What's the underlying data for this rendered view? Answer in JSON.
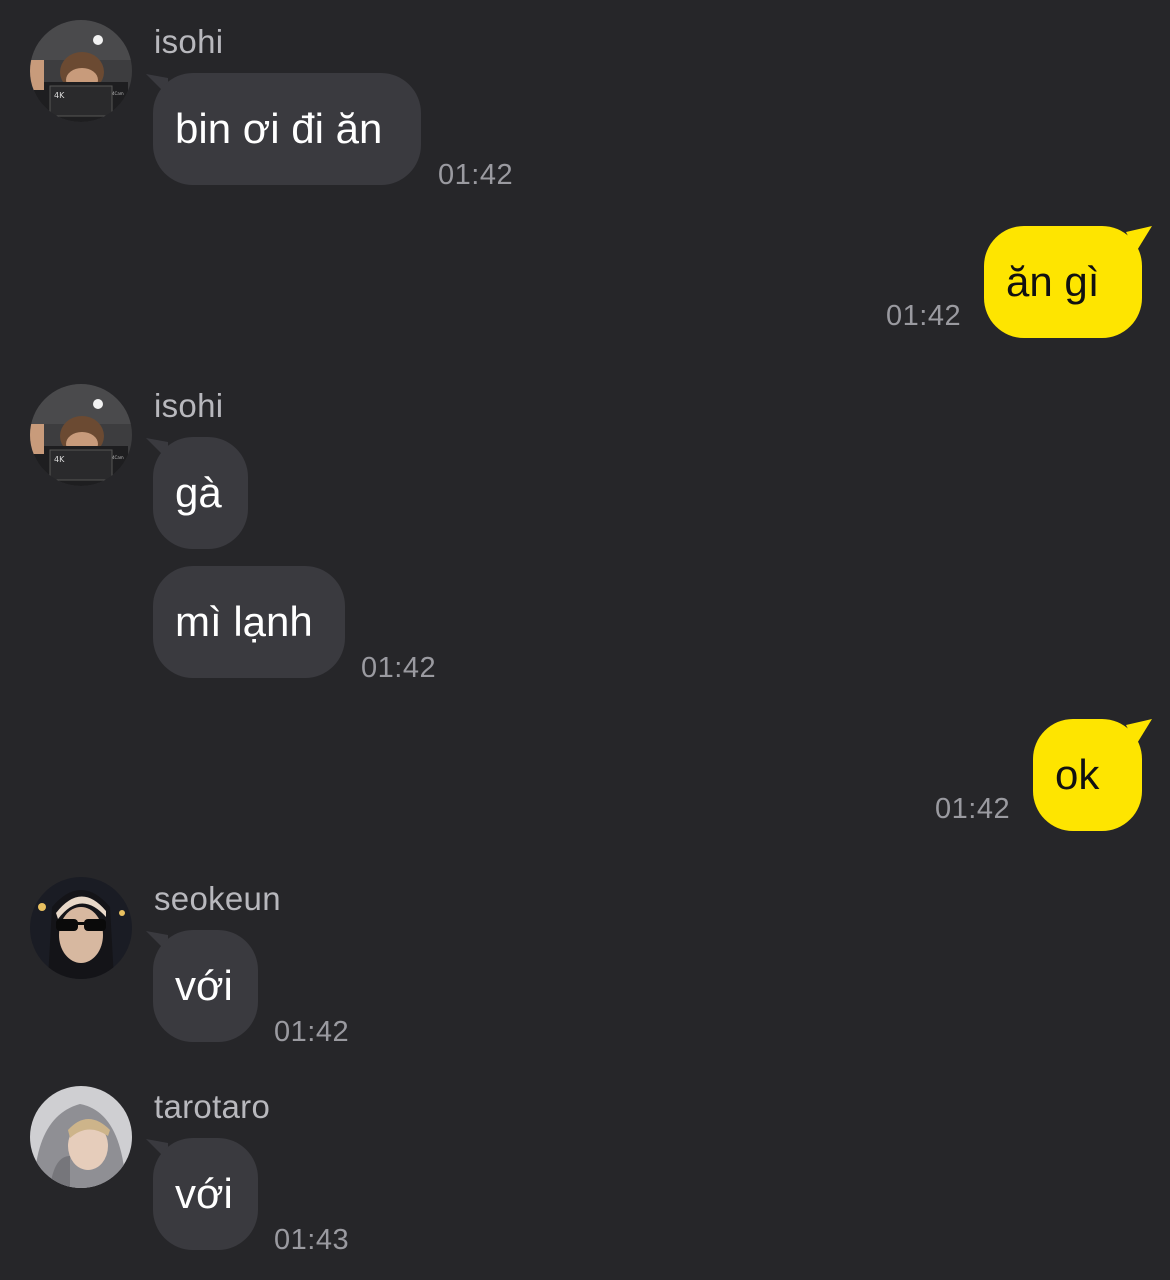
{
  "colors": {
    "background": "#262629",
    "incoming_bubble": "#3a3a3f",
    "outgoing_bubble": "#fee500",
    "timestamp": "#9a9aa0",
    "sender_name": "#b8b8bd"
  },
  "messages": [
    {
      "direction": "in",
      "sender": "isohi",
      "avatar_icon": "user-avatar-isohi-icon",
      "texts": [
        "bin ơi đi ăn"
      ],
      "time": "01:42"
    },
    {
      "direction": "out",
      "texts": [
        "ăn gì"
      ],
      "time": "01:42"
    },
    {
      "direction": "in",
      "sender": "isohi",
      "avatar_icon": "user-avatar-isohi-icon",
      "texts": [
        "gà",
        "mì lạnh"
      ],
      "time": "01:42"
    },
    {
      "direction": "out",
      "texts": [
        "ok"
      ],
      "time": "01:42"
    },
    {
      "direction": "in",
      "sender": "seokeun",
      "avatar_icon": "user-avatar-seokeun-icon",
      "texts": [
        "với"
      ],
      "time": "01:42"
    },
    {
      "direction": "in",
      "sender": "tarotaro",
      "avatar_icon": "user-avatar-tarotaro-icon",
      "texts": [
        "với"
      ],
      "time": "01:43"
    }
  ]
}
